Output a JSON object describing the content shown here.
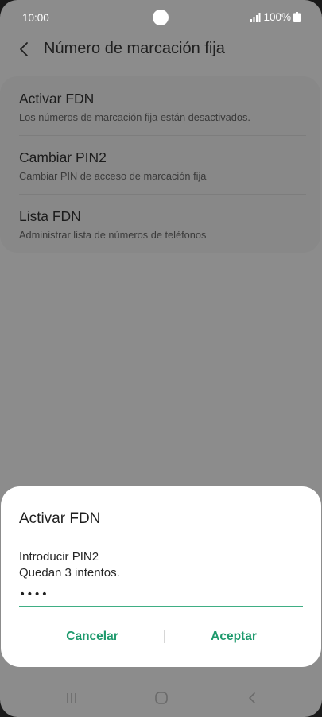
{
  "status_bar": {
    "time": "10:00",
    "battery": "100%"
  },
  "header": {
    "title": "Número de marcación fija"
  },
  "settings": {
    "items": [
      {
        "title": "Activar FDN",
        "subtitle": "Los números de marcación fija están desactivados."
      },
      {
        "title": "Cambiar PIN2",
        "subtitle": "Cambiar PIN de acceso de marcación fija"
      },
      {
        "title": "Lista FDN",
        "subtitle": "Administrar lista de números de teléfonos"
      }
    ]
  },
  "dialog": {
    "title": "Activar FDN",
    "prompt": "Introducir PIN2",
    "attempts": "Quedan 3 intentos.",
    "pin_value": "••••",
    "cancel_label": "Cancelar",
    "accept_label": "Aceptar"
  },
  "colors": {
    "accent": "#1e9a6d",
    "input_underline": "#3fae84",
    "dimmed_background": "#8c8c8c",
    "dialog_background": "#ffffff"
  },
  "icons": {
    "back": "chevron-left-icon",
    "signal": "signal-icon",
    "battery": "battery-icon",
    "nav_recents": "recents-icon",
    "nav_home": "home-icon",
    "nav_back": "nav-back-icon"
  }
}
